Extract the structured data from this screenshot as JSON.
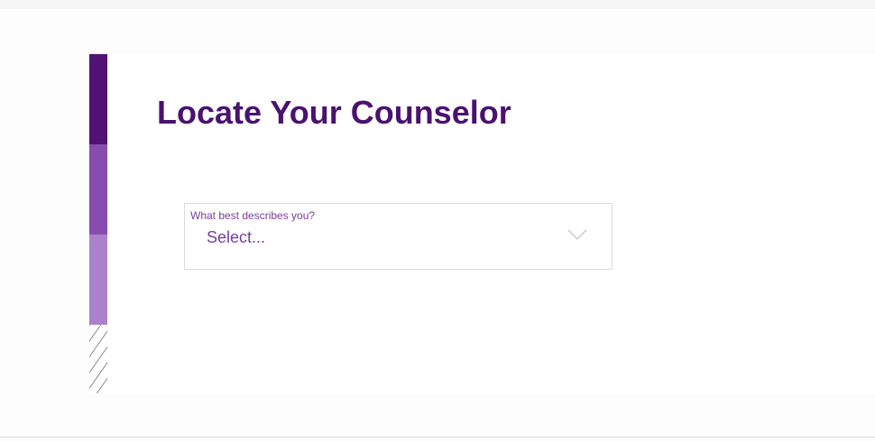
{
  "page": {
    "title": "Locate Your Counselor"
  },
  "select": {
    "label": "What best describes you?",
    "value": "Select...",
    "icon": "chevron-down-icon"
  },
  "colors": {
    "title": "#4b1170",
    "accent_dark": "#521175",
    "accent_mid": "#884cb0",
    "accent_light": "#ab81cb",
    "select_text": "#7a3d9c"
  }
}
